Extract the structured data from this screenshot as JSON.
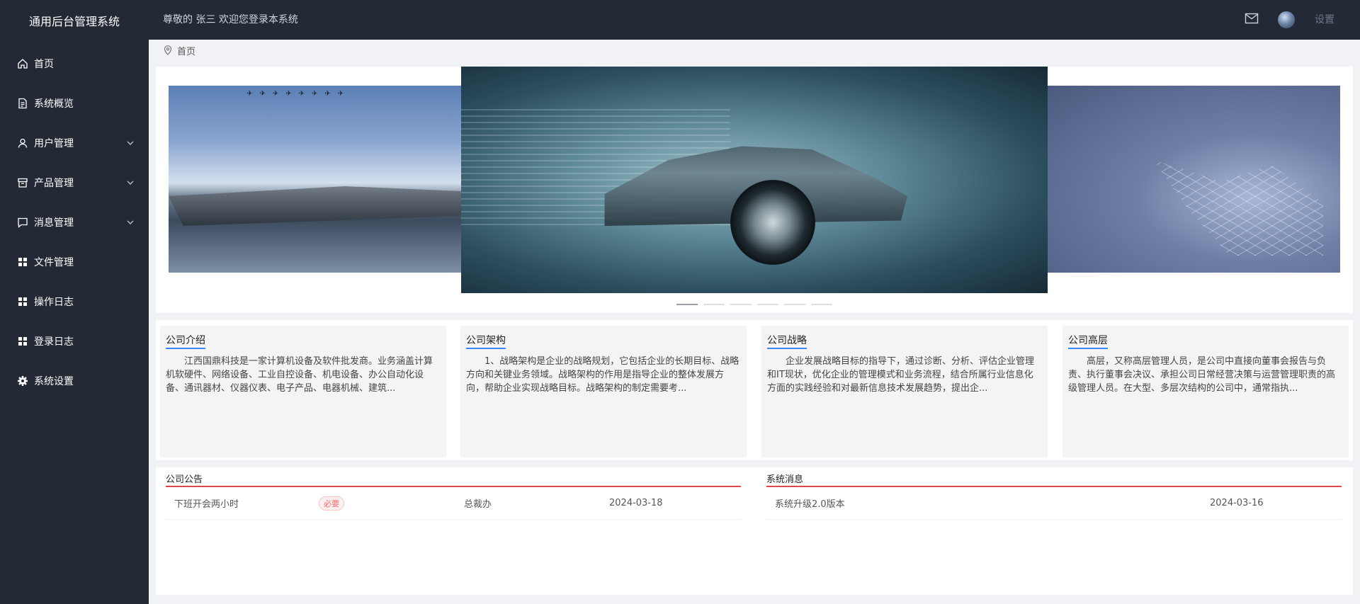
{
  "app": {
    "title": "通用后台管理系统"
  },
  "header": {
    "welcome": "尊敬的 张三 欢迎您登录本系统",
    "settings_label": "设置"
  },
  "sidebar": {
    "items": [
      {
        "label": "首页",
        "icon": "home-icon",
        "has_submenu": false
      },
      {
        "label": "系统概览",
        "icon": "document-icon",
        "has_submenu": false
      },
      {
        "label": "用户管理",
        "icon": "user-icon",
        "has_submenu": true
      },
      {
        "label": "产品管理",
        "icon": "box-icon",
        "has_submenu": true
      },
      {
        "label": "消息管理",
        "icon": "chat-icon",
        "has_submenu": true
      },
      {
        "label": "文件管理",
        "icon": "grid-icon",
        "has_submenu": false
      },
      {
        "label": "操作日志",
        "icon": "grid-icon",
        "has_submenu": false
      },
      {
        "label": "登录日志",
        "icon": "grid-icon",
        "has_submenu": false
      },
      {
        "label": "系统设置",
        "icon": "gear-icon",
        "has_submenu": false
      }
    ]
  },
  "breadcrumb": {
    "current": "首页"
  },
  "carousel": {
    "slide_count": 6,
    "active_index": 0
  },
  "cards": [
    {
      "title": "公司介绍",
      "text": "江西国鼎科技是一家计算机设备及软件批发商。业务涵盖计算机软硬件、网络设备、工业自控设备、机电设备、办公自动化设备、通讯器材、仪器仪表、电子产品、电器机械、建筑..."
    },
    {
      "title": "公司架构",
      "text": "1、战略架构是企业的战略规划，它包括企业的长期目标、战略方向和关键业务领域。战略架构的作用是指导企业的整体发展方向，帮助企业实现战略目标。战略架构的制定需要考..."
    },
    {
      "title": "公司战略",
      "text": "企业发展战略目标的指导下，通过诊断、分析、评估企业管理和IT现状，优化企业的管理模式和业务流程，结合所属行业信息化方面的实践经验和对最新信息技术发展趋势，提出企..."
    },
    {
      "title": "公司高层",
      "text": "高层，又称高层管理人员，是公司中直接向董事会报告与负责、执行董事会决议、承担公司日常经营决策与运营管理职责的高级管理人员。在大型、多层次结构的公司中，通常指执..."
    }
  ],
  "announcements": {
    "title": "公司公告",
    "rows": [
      {
        "subject": "下班开会两小时",
        "tag": "必要",
        "department": "总裁办",
        "date": "2024-03-18"
      }
    ]
  },
  "system_messages": {
    "title": "系统消息",
    "rows": [
      {
        "subject": "系统升级2.0版本",
        "date": "2024-03-16"
      }
    ]
  }
}
